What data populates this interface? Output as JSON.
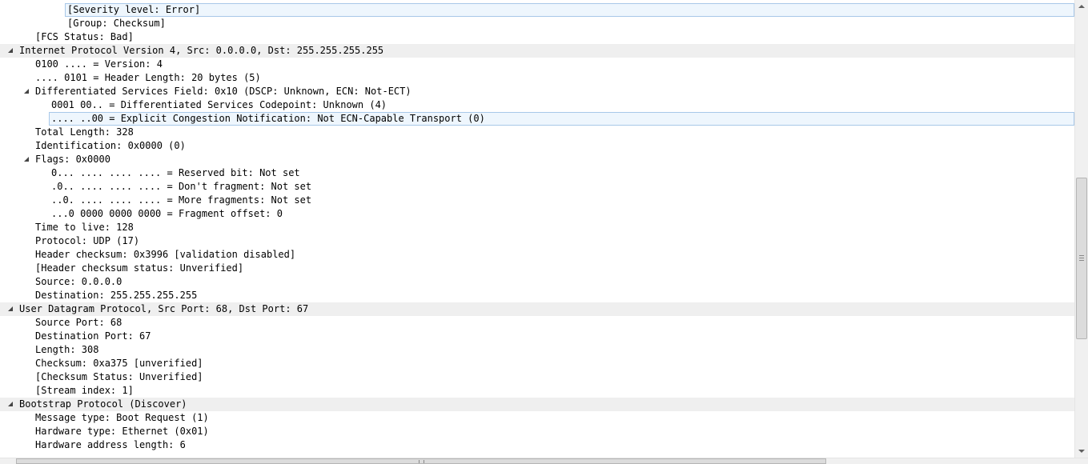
{
  "tree": {
    "rows": [
      {
        "text": "[Severity level: Error]",
        "selected": true
      },
      {
        "text": "[Group: Checksum]"
      },
      {
        "text": "[FCS Status: Bad]"
      },
      {
        "text": "Internet Protocol Version 4, Src: 0.0.0.0, Dst: 255.255.255.255",
        "header": true,
        "expanded": true
      },
      {
        "text": "0100 .... = Version: 4"
      },
      {
        "text": ".... 0101 = Header Length: 20 bytes (5)"
      },
      {
        "text": "Differentiated Services Field: 0x10 (DSCP: Unknown, ECN: Not-ECT)",
        "expanded": true
      },
      {
        "text": "0001 00.. = Differentiated Services Codepoint: Unknown (4)"
      },
      {
        "text": ".... ..00 = Explicit Congestion Notification: Not ECN-Capable Transport (0)",
        "selected": true
      },
      {
        "text": "Total Length: 328"
      },
      {
        "text": "Identification: 0x0000 (0)"
      },
      {
        "text": "Flags: 0x0000",
        "expanded": true
      },
      {
        "text": "0... .... .... .... = Reserved bit: Not set"
      },
      {
        "text": ".0.. .... .... .... = Don't fragment: Not set"
      },
      {
        "text": "..0. .... .... .... = More fragments: Not set"
      },
      {
        "text": "...0 0000 0000 0000 = Fragment offset: 0"
      },
      {
        "text": "Time to live: 128"
      },
      {
        "text": "Protocol: UDP (17)"
      },
      {
        "text": "Header checksum: 0x3996 [validation disabled]"
      },
      {
        "text": "[Header checksum status: Unverified]"
      },
      {
        "text": "Source: 0.0.0.0"
      },
      {
        "text": "Destination: 255.255.255.255"
      },
      {
        "text": "User Datagram Protocol, Src Port: 68, Dst Port: 67",
        "header": true,
        "expanded": true
      },
      {
        "text": "Source Port: 68"
      },
      {
        "text": "Destination Port: 67"
      },
      {
        "text": "Length: 308"
      },
      {
        "text": "Checksum: 0xa375 [unverified]"
      },
      {
        "text": "[Checksum Status: Unverified]"
      },
      {
        "text": "[Stream index: 1]"
      },
      {
        "text": "Bootstrap Protocol (Discover)",
        "header": true,
        "expanded": true
      },
      {
        "text": "Message type: Boot Request (1)"
      },
      {
        "text": "Hardware type: Ethernet (0x01)"
      },
      {
        "text": "Hardware address length: 6"
      }
    ]
  },
  "colors": {
    "header_band": "#efefef",
    "selection_border": "#a8c8e8",
    "selection_fill": "#eef6fd",
    "scrollbar_track": "#f0f0f0"
  },
  "icons": {
    "expanded": "expanded-triangle-icon"
  }
}
